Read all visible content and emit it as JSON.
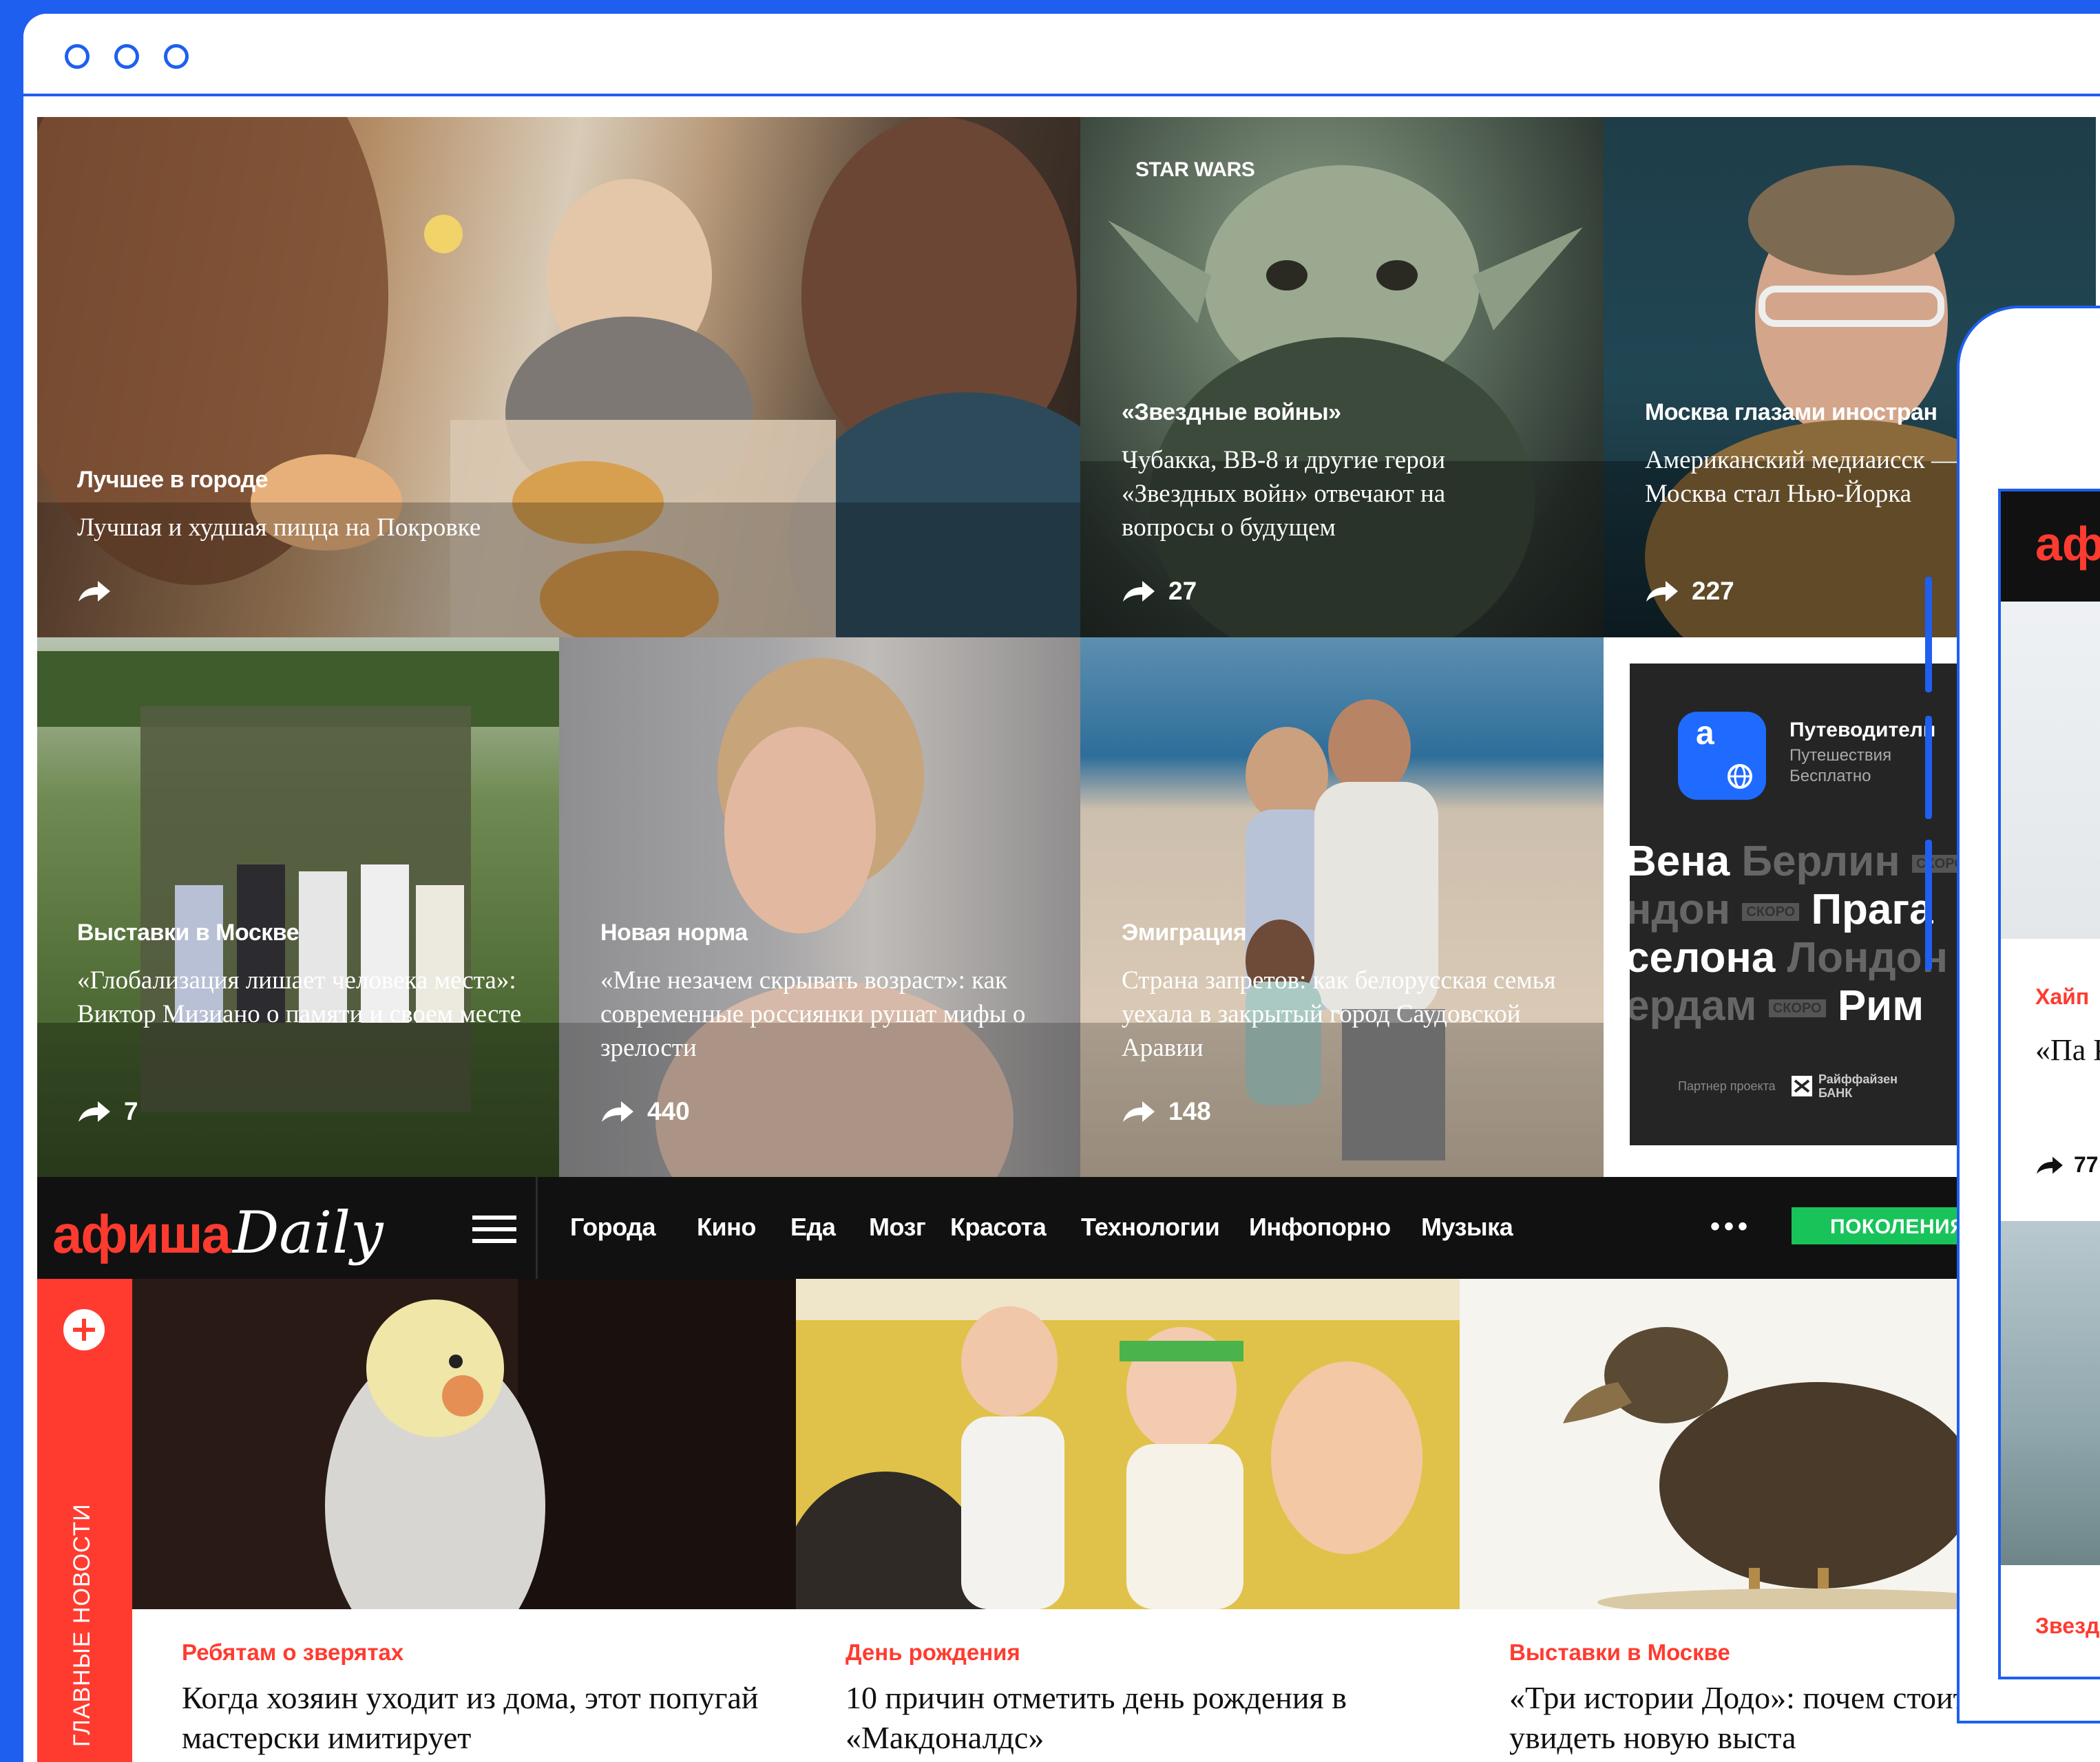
{
  "tiles_top": [
    {
      "rubric": "Лучшее в городе",
      "headline": "Лучшая и худшая пицца на Покровке",
      "shares": ""
    },
    {
      "kicker": "STAR WARS",
      "rubric": "«Звездные войны»",
      "headline": "Чубакка, BB-8 и другие герои «Звездных войн» отвечают на вопросы о будущем",
      "shares": "27"
    },
    {
      "rubric": "Москва глазами иностран",
      "headline": "Американский медиаисск — о том, как Москва стал Нью-Йорка",
      "shares": "227"
    }
  ],
  "tiles_mid": [
    {
      "rubric": "Выставки в Москве",
      "headline": "«Глобализация лишает человека места»: Виктор Мизиано о памяти и своем месте",
      "shares": "7"
    },
    {
      "rubric": "Новая норма",
      "headline": "«Мне незачем скрывать возраст»: как современные россиянки рушат мифы о зрелости",
      "shares": "440"
    },
    {
      "rubric": "Эмиграция",
      "headline": "Страна запретов: как белорусская семья уехала в закрытый город Саудовской Аравии",
      "shares": "148"
    }
  ],
  "ad": {
    "app_icon_letter": "a",
    "title": "Путеводители",
    "subtitle": "Путешествия",
    "price": "Бесплатно",
    "line1_a": "Вена",
    "line1_b": "Берлин",
    "line1_badge": "СКОРО",
    "line2_a": "ндон",
    "line2_badge": "СКОРО",
    "line2_b": "Прага",
    "line3_a": "селона",
    "line3_b": "Лондон",
    "line4_a": "ердам",
    "line4_badge": "СКОРО",
    "line4_b": "Рим",
    "partner_label": "Партнер проекта",
    "bank": "Райффайзен БАНК"
  },
  "nav": {
    "logo_afisha": "афиша",
    "logo_daily": "Daily",
    "items": [
      "Города",
      "Кино",
      "Еда",
      "Мозг",
      "Красота",
      "Технологии",
      "Инфопорно",
      "Музыка"
    ],
    "more": "•••",
    "promo": "ПОКОЛЕНИЯ"
  },
  "sidebar": {
    "label": "ГЛАВНЫЕ НОВОСТИ"
  },
  "cards": [
    {
      "rubric": "Ребятам о зверятах",
      "title": "Когда хозяин уходит из дома, этот попугай мастерски имитирует"
    },
    {
      "rubric": "День рождения",
      "title": "10 причин отметить день рождения в «Макдоналдс»"
    },
    {
      "rubric": "Выставки в Москве",
      "title": "«Три истории Додо»: почем стоит увидеть новую выста"
    }
  ],
  "phone": {
    "logo": "аф",
    "rubric": "Хайп",
    "title": "«Пa Киза",
    "shares": "77",
    "rubric2": "Звезд"
  },
  "colors": {
    "accent": "#ff3b30",
    "frame": "#1f5ff0",
    "promo": "#18c35a"
  }
}
